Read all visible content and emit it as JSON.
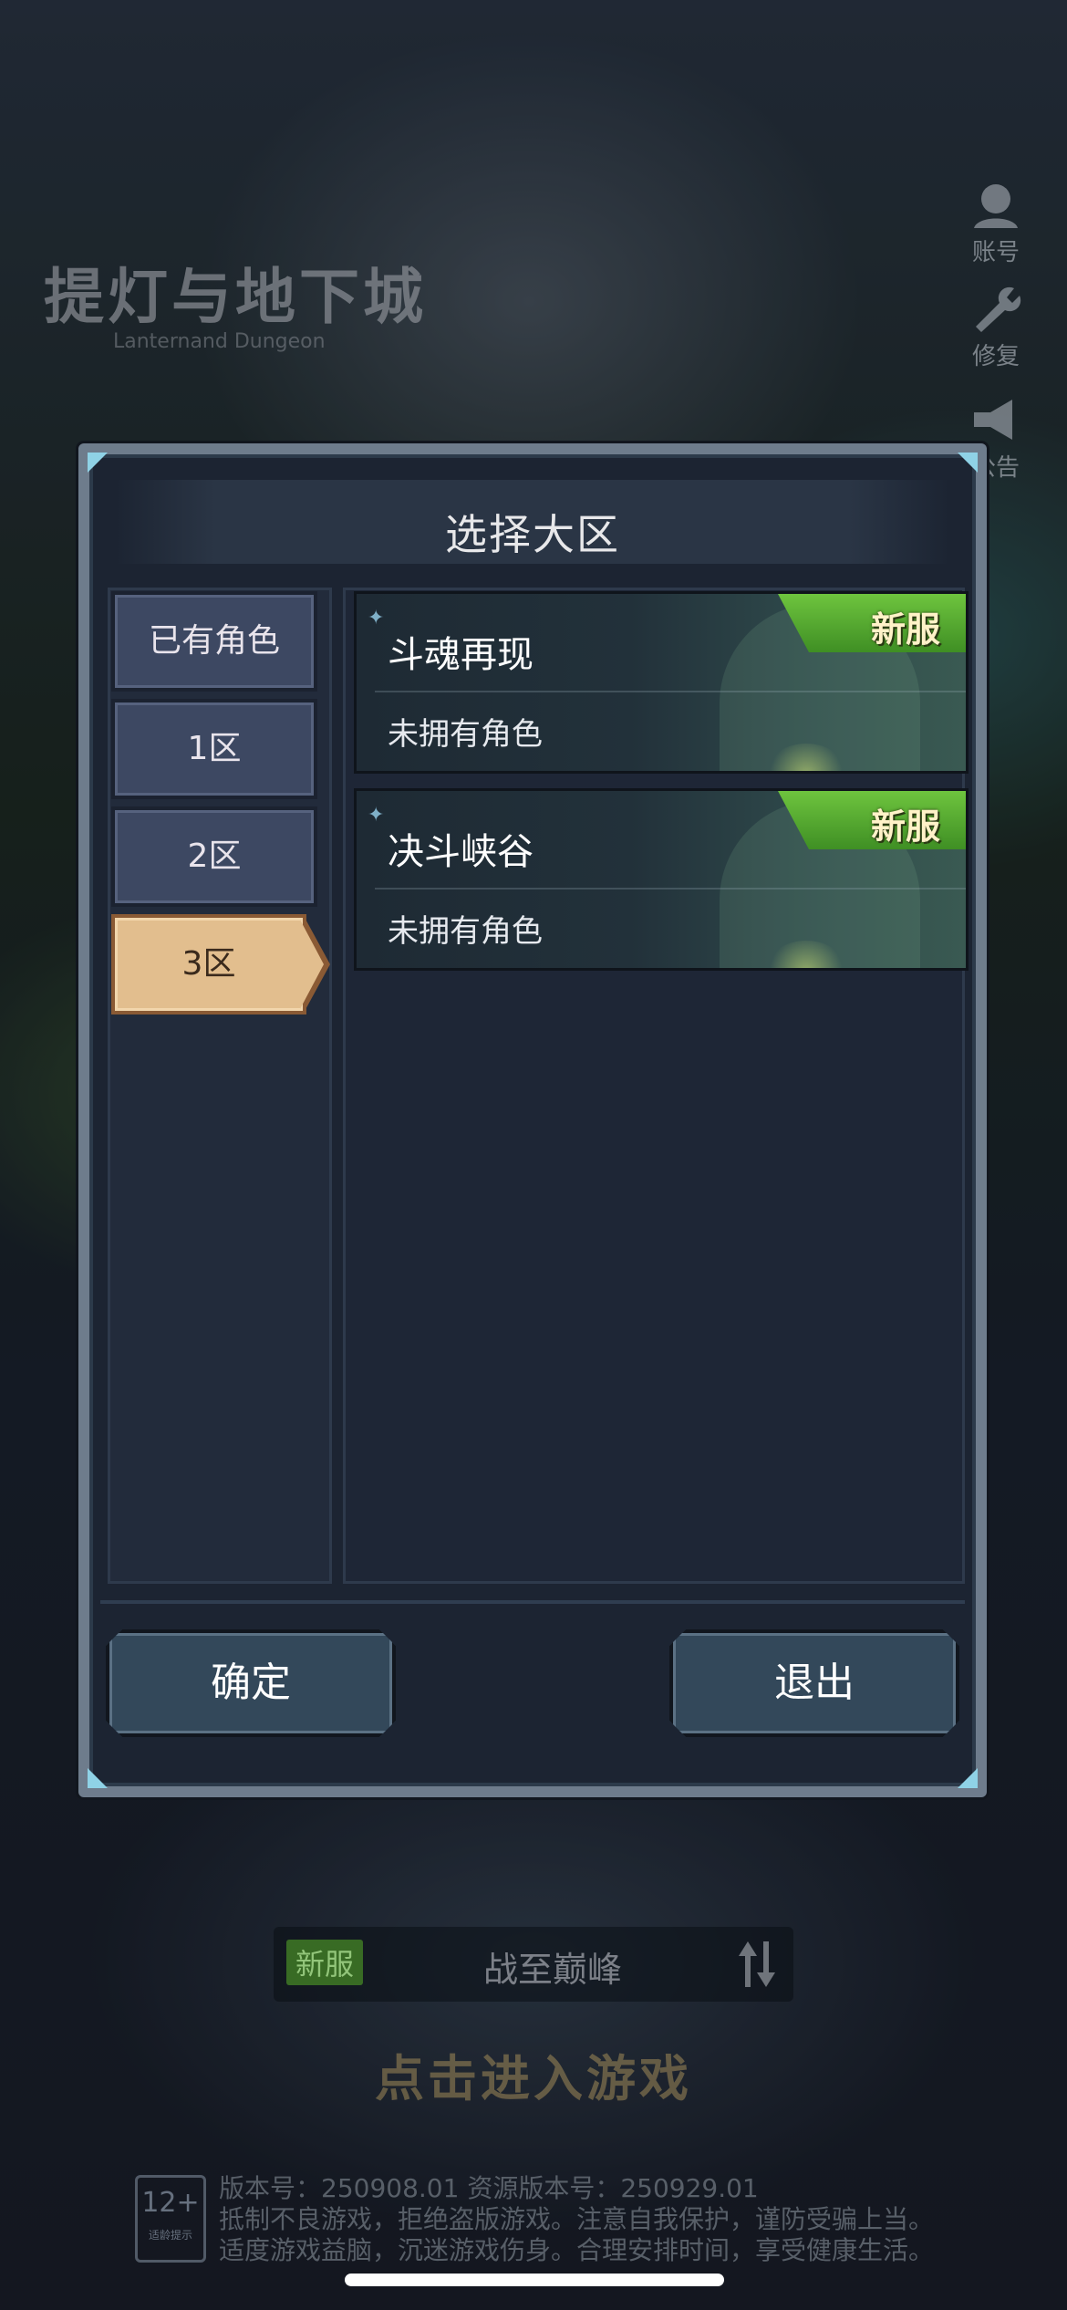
{
  "background": {
    "logo_title": "提灯与地下城",
    "logo_subtitle": "Lanternand Dungeon"
  },
  "side_menu": [
    {
      "label": "账号",
      "icon": "account-icon"
    },
    {
      "label": "修复",
      "icon": "wrench-icon"
    },
    {
      "label": "公告",
      "icon": "megaphone-icon"
    }
  ],
  "dialog": {
    "title": "选择大区",
    "tabs": [
      {
        "label": "已有角色",
        "active": false
      },
      {
        "label": "1区",
        "active": false
      },
      {
        "label": "2区",
        "active": false
      },
      {
        "label": "3区",
        "active": true
      }
    ],
    "servers": [
      {
        "name": "斗魂再现",
        "status": "未拥有角色",
        "badge": "新服"
      },
      {
        "name": "决斗峡谷",
        "status": "未拥有角色",
        "badge": "新服"
      }
    ],
    "confirm_label": "确定",
    "exit_label": "退出"
  },
  "bottom": {
    "server_tag": "新服",
    "server_name": "战至巅峰",
    "enter_label": "点击进入游戏",
    "age_rating": "12+",
    "age_note": "适龄提示",
    "version_line": "版本号：250908.01  资源版本号：250929.01",
    "legal_line1": "抵制不良游戏，拒绝盗版游戏。注意自我保护，谨防受骗上当。",
    "legal_line2": "适度游戏益脑，沉迷游戏伤身。合理安排时间，享受健康生活。"
  },
  "colors": {
    "accent_new": "#4fa62c",
    "tab_active": "#e2be8e",
    "panel": "#1c2432"
  }
}
